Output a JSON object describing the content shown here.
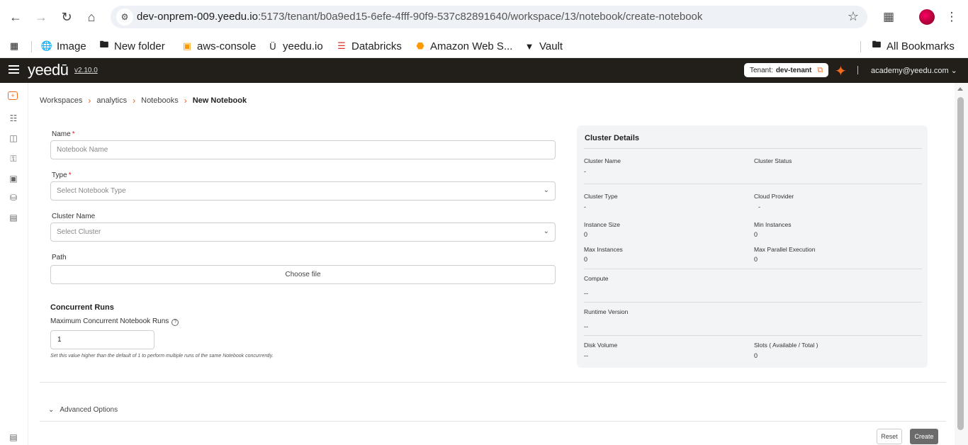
{
  "browser": {
    "url_host": "dev-onprem-009.yeedu.io",
    "url_path": ":5173/tenant/b0a9ed15-6efe-4fff-90f9-537c82891640/workspace/13/notebook/create-notebook",
    "bookmarks": [
      {
        "label": "Image",
        "icon": "globe-icon"
      },
      {
        "label": "New folder",
        "icon": "folder-icon"
      },
      {
        "label": "aws-console",
        "icon": "aws-icon"
      },
      {
        "label": "yeedu.io",
        "icon": "yeedu-icon"
      },
      {
        "label": "Databricks",
        "icon": "databricks-icon"
      },
      {
        "label": "Amazon Web S...",
        "icon": "aws-box-icon"
      },
      {
        "label": "Vault",
        "icon": "vault-icon"
      }
    ],
    "all_bookmarks": "All Bookmarks"
  },
  "app": {
    "logo": "yeedū",
    "version": "v2.10.0",
    "tenant_label": "Tenant:",
    "tenant_name": "dev-tenant",
    "user_email": "academy@yeedu.com",
    "accent": "#f26b1d"
  },
  "breadcrumbs": [
    "Workspaces",
    "analytics",
    "Notebooks",
    "New Notebook"
  ],
  "form": {
    "name_label": "Name",
    "name_placeholder": "Notebook Name",
    "type_label": "Type",
    "type_placeholder": "Select Notebook Type",
    "cluster_label": "Cluster Name",
    "cluster_placeholder": "Select Cluster",
    "path_label": "Path",
    "path_button": "Choose file",
    "concurrent_title": "Concurrent Runs",
    "max_runs_label": "Maximum Concurrent Notebook Runs",
    "max_runs_value": "1",
    "max_runs_help": "Set this value higher than the default of 1 to perform multiple runs of the same Notebook concurrently.",
    "required_mark": "*"
  },
  "cluster_details": {
    "title": "Cluster Details",
    "cluster_name_label": "Cluster Name",
    "cluster_name_value": "-",
    "cluster_status_label": "Cluster Status",
    "cluster_type_label": "Cluster Type",
    "cluster_type_value": "-",
    "cloud_provider_label": "Cloud Provider",
    "cloud_provider_value": "-",
    "instance_size_label": "Instance Size",
    "instance_size_value": "0",
    "min_instances_label": "Min Instances",
    "min_instances_value": "0",
    "max_instances_label": "Max Instances",
    "max_instances_value": "0",
    "max_parallel_label": "Max Parallel Execution",
    "max_parallel_value": "0",
    "compute_label": "Compute",
    "compute_value": "--",
    "runtime_label": "Runtime Version",
    "runtime_value": "--",
    "disk_label": "Disk Volume",
    "disk_value": "--",
    "slots_label": "Slots ( Available / Total )",
    "slots_value": "0"
  },
  "advanced": {
    "label": "Advanced Options"
  },
  "actions": {
    "reset": "Reset",
    "create": "Create"
  }
}
